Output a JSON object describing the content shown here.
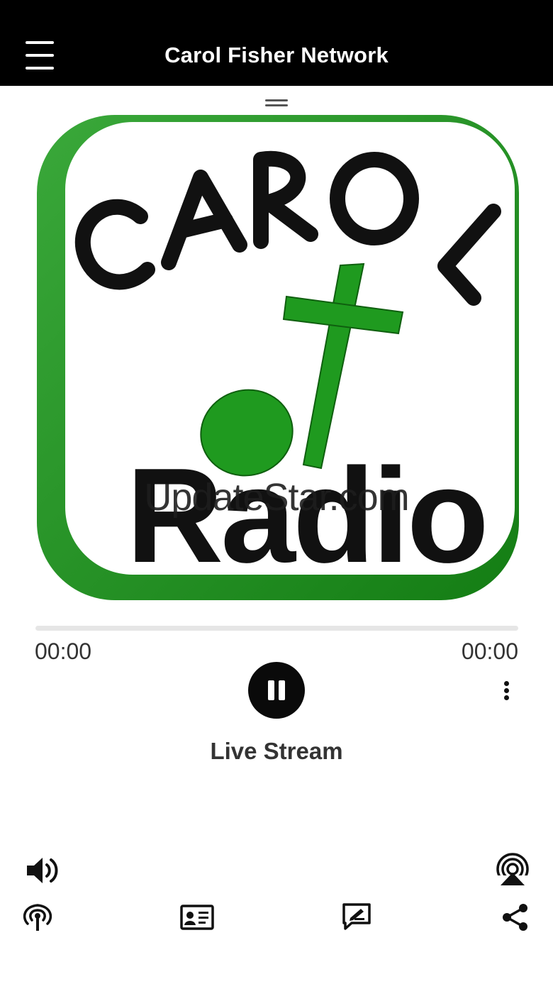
{
  "header": {
    "title": "Carol Fisher Network",
    "menu_icon": "hamburger-menu-icon"
  },
  "artwork": {
    "logo_text_top": "CAROL",
    "logo_text_bottom": "Radio",
    "watermark": "UpdateStar.com",
    "brand_green": "#1f9a1f"
  },
  "player": {
    "elapsed": "00:00",
    "duration": "00:00",
    "progress": 0,
    "state": "playing",
    "track_title": "Live Stream"
  },
  "toolbar": {
    "top_left_icon": "volume-icon",
    "top_right_icon": "airplay-icon",
    "bottom_icons": [
      "podcast-icon",
      "contact-card-icon",
      "feedback-icon",
      "share-icon"
    ]
  },
  "colors": {
    "header_bg": "#000000",
    "text": "#333333",
    "play_button": "#0a0a0a"
  }
}
